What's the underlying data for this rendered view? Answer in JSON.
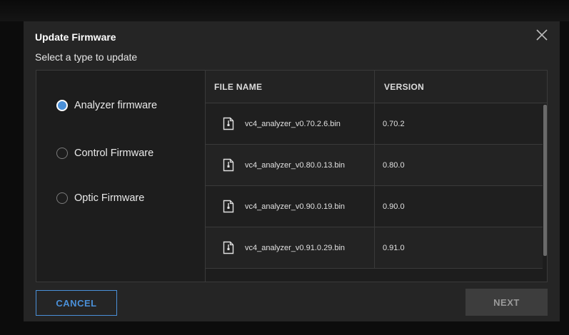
{
  "dialog": {
    "title": "Update Firmware",
    "subtitle": "Select a type to update",
    "close_icon": "close-icon"
  },
  "firmware_types": [
    {
      "label": "Analyzer firmware",
      "selected": true
    },
    {
      "label": "Control Firmware",
      "selected": false
    },
    {
      "label": "Optic Firmware",
      "selected": false
    }
  ],
  "table": {
    "columns": [
      "FILE NAME",
      "VERSION"
    ],
    "rows": [
      {
        "file": "vc4_analyzer_v0.70.2.6.bin",
        "version": "0.70.2"
      },
      {
        "file": "vc4_analyzer_v0.80.0.13.bin",
        "version": "0.80.0"
      },
      {
        "file": "vc4_analyzer_v0.90.0.19.bin",
        "version": "0.90.0"
      },
      {
        "file": "vc4_analyzer_v0.91.0.29.bin",
        "version": "0.91.0"
      }
    ]
  },
  "buttons": {
    "cancel": "CANCEL",
    "next": "NEXT"
  },
  "colors": {
    "accent": "#4a90d9",
    "dialog_bg": "#252525",
    "panel_bg": "#1d1d1d"
  }
}
